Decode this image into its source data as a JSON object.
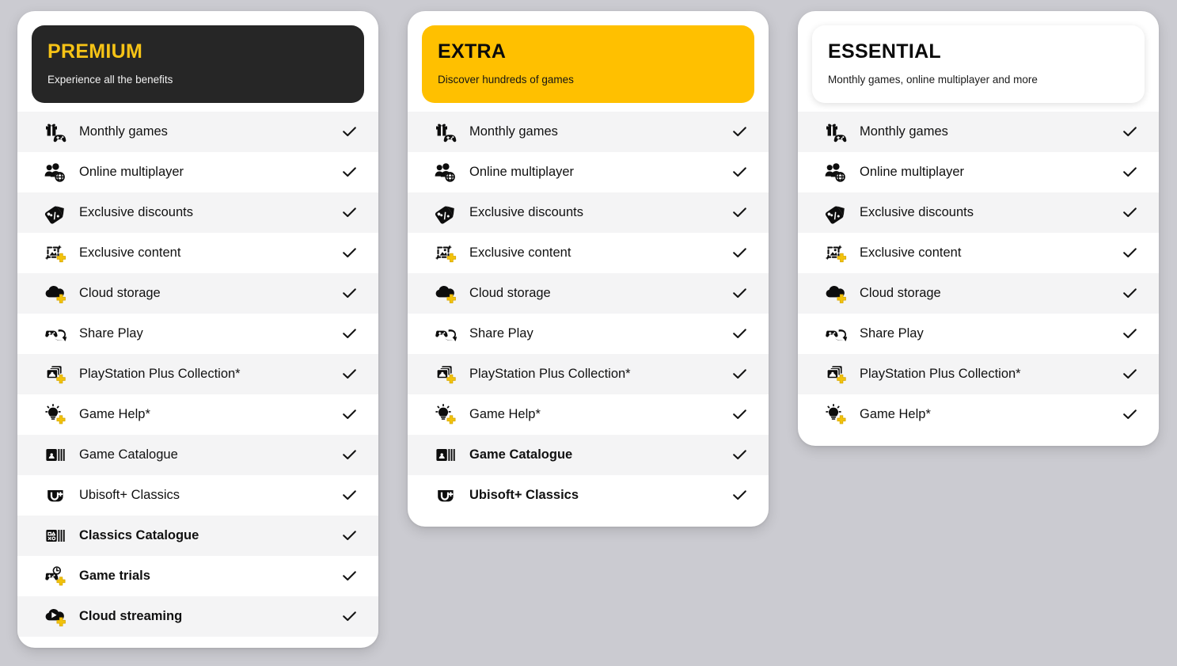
{
  "page": {
    "background_color": "#cbcbd1",
    "accent_yellow": "#ffc000",
    "gold_text": "#f6c316",
    "dark": "#262626",
    "stripe": "#f4f4f5"
  },
  "plans": [
    {
      "id": "premium",
      "title": "PREMIUM",
      "subtitle": "Experience all the benefits",
      "header_style": "dark",
      "features": [
        {
          "icon": "monthly-games-icon",
          "label": "Monthly games",
          "check": true,
          "bold": false
        },
        {
          "icon": "online-multiplayer-icon",
          "label": "Online multiplayer",
          "check": true,
          "bold": false
        },
        {
          "icon": "exclusive-discounts-icon",
          "label": "Exclusive discounts",
          "check": true,
          "bold": false
        },
        {
          "icon": "exclusive-content-icon",
          "label": "Exclusive content",
          "check": true,
          "bold": false
        },
        {
          "icon": "cloud-storage-icon",
          "label": "Cloud storage",
          "check": true,
          "bold": false
        },
        {
          "icon": "share-play-icon",
          "label": "Share Play",
          "check": true,
          "bold": false
        },
        {
          "icon": "ps-plus-collection-icon",
          "label": "PlayStation Plus Collection*",
          "check": true,
          "bold": false
        },
        {
          "icon": "game-help-icon",
          "label": "Game Help*",
          "check": true,
          "bold": false
        },
        {
          "icon": "game-catalogue-icon",
          "label": "Game Catalogue",
          "check": true,
          "bold": false
        },
        {
          "icon": "ubisoft-plus-icon",
          "label": "Ubisoft+ Classics",
          "check": true,
          "bold": false
        },
        {
          "icon": "classics-catalogue-icon",
          "label": "Classics Catalogue",
          "check": true,
          "bold": true
        },
        {
          "icon": "game-trials-icon",
          "label": "Game trials",
          "check": true,
          "bold": true
        },
        {
          "icon": "cloud-streaming-icon",
          "label": "Cloud streaming",
          "check": true,
          "bold": true
        }
      ]
    },
    {
      "id": "extra",
      "title": "EXTRA",
      "subtitle": "Discover hundreds of games",
      "header_style": "yellow",
      "features": [
        {
          "icon": "monthly-games-icon",
          "label": "Monthly games",
          "check": true,
          "bold": false
        },
        {
          "icon": "online-multiplayer-icon",
          "label": "Online multiplayer",
          "check": true,
          "bold": false
        },
        {
          "icon": "exclusive-discounts-icon",
          "label": "Exclusive discounts",
          "check": true,
          "bold": false
        },
        {
          "icon": "exclusive-content-icon",
          "label": "Exclusive content",
          "check": true,
          "bold": false
        },
        {
          "icon": "cloud-storage-icon",
          "label": "Cloud storage",
          "check": true,
          "bold": false
        },
        {
          "icon": "share-play-icon",
          "label": "Share Play",
          "check": true,
          "bold": false
        },
        {
          "icon": "ps-plus-collection-icon",
          "label": "PlayStation Plus Collection*",
          "check": true,
          "bold": false
        },
        {
          "icon": "game-help-icon",
          "label": "Game Help*",
          "check": true,
          "bold": false
        },
        {
          "icon": "game-catalogue-icon",
          "label": "Game Catalogue",
          "check": true,
          "bold": true
        },
        {
          "icon": "ubisoft-plus-icon",
          "label": "Ubisoft+ Classics",
          "check": true,
          "bold": true
        }
      ]
    },
    {
      "id": "essential",
      "title": "ESSENTIAL",
      "subtitle": "Monthly games, online multiplayer and more",
      "header_style": "white",
      "features": [
        {
          "icon": "monthly-games-icon",
          "label": "Monthly games",
          "check": true,
          "bold": false
        },
        {
          "icon": "online-multiplayer-icon",
          "label": "Online multiplayer",
          "check": true,
          "bold": false
        },
        {
          "icon": "exclusive-discounts-icon",
          "label": "Exclusive discounts",
          "check": true,
          "bold": false
        },
        {
          "icon": "exclusive-content-icon",
          "label": "Exclusive content",
          "check": true,
          "bold": false
        },
        {
          "icon": "cloud-storage-icon",
          "label": "Cloud storage",
          "check": true,
          "bold": false
        },
        {
          "icon": "share-play-icon",
          "label": "Share Play",
          "check": true,
          "bold": false
        },
        {
          "icon": "ps-plus-collection-icon",
          "label": "PlayStation Plus Collection*",
          "check": true,
          "bold": false
        },
        {
          "icon": "game-help-icon",
          "label": "Game Help*",
          "check": true,
          "bold": false
        }
      ]
    }
  ]
}
